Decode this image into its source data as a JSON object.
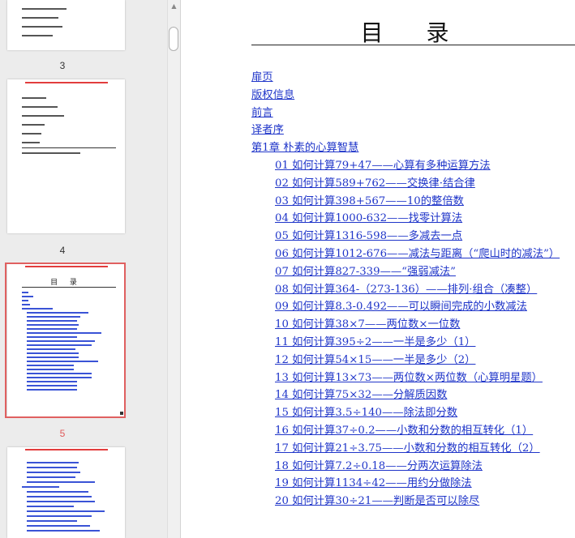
{
  "thumbnails": {
    "page_numbers": [
      "3",
      "4",
      "5"
    ],
    "active_page": "5",
    "mini_toc_title": "目 录"
  },
  "document": {
    "title": "目 录",
    "toc_top": [
      {
        "label": "扉页"
      },
      {
        "label": "版权信息"
      },
      {
        "label": "前言"
      },
      {
        "label": "译者序"
      },
      {
        "label": "第1章 朴素的心算智慧"
      }
    ],
    "toc_sections": [
      {
        "label": "01 如何计算79+47——心算有多种运算方法"
      },
      {
        "label": "02 如何计算589+762——交换律·结合律"
      },
      {
        "label": "03 如何计算398+567——10的整倍数"
      },
      {
        "label": "04 如何计算1000-632——找零计算法"
      },
      {
        "label": "05 如何计算1316-598——多减去一点"
      },
      {
        "label": "06 如何计算1012-676——减法与距离（“爬山时的减法”）"
      },
      {
        "label": "07 如何计算827-339——“强弱减法”"
      },
      {
        "label": "08 如何计算364-（273-136）——排列·组合（凑整）"
      },
      {
        "label": "09 如何计算8.3-0.492——可以瞬间完成的小数减法"
      },
      {
        "label": "10 如何计算38×7——两位数×一位数"
      },
      {
        "label": "11 如何计算395÷2——一半是多少（1）"
      },
      {
        "label": "12 如何计算54×15——一半是多少（2）"
      },
      {
        "label": "13 如何计算13×73——两位数×两位数（心算明星题）"
      },
      {
        "label": "14 如何计算75×32——分解质因数"
      },
      {
        "label": "15 如何计算3.5÷140——除法即分数"
      },
      {
        "label": "16 如何计算37÷0.2——小数和分数的相互转化（1）"
      },
      {
        "label": "17 如何计算21÷3.75——小数和分数的相互转化（2）"
      },
      {
        "label": "18 如何计算7.2÷0.18——分两次运算除法"
      },
      {
        "label": "19 如何计算1134÷42——用约分做除法"
      },
      {
        "label": "20 如何计算30÷21——判断是否可以除尽"
      }
    ]
  },
  "colors": {
    "link": "#1f35c9",
    "selection": "#e06060",
    "pane_bg": "#ececec"
  }
}
